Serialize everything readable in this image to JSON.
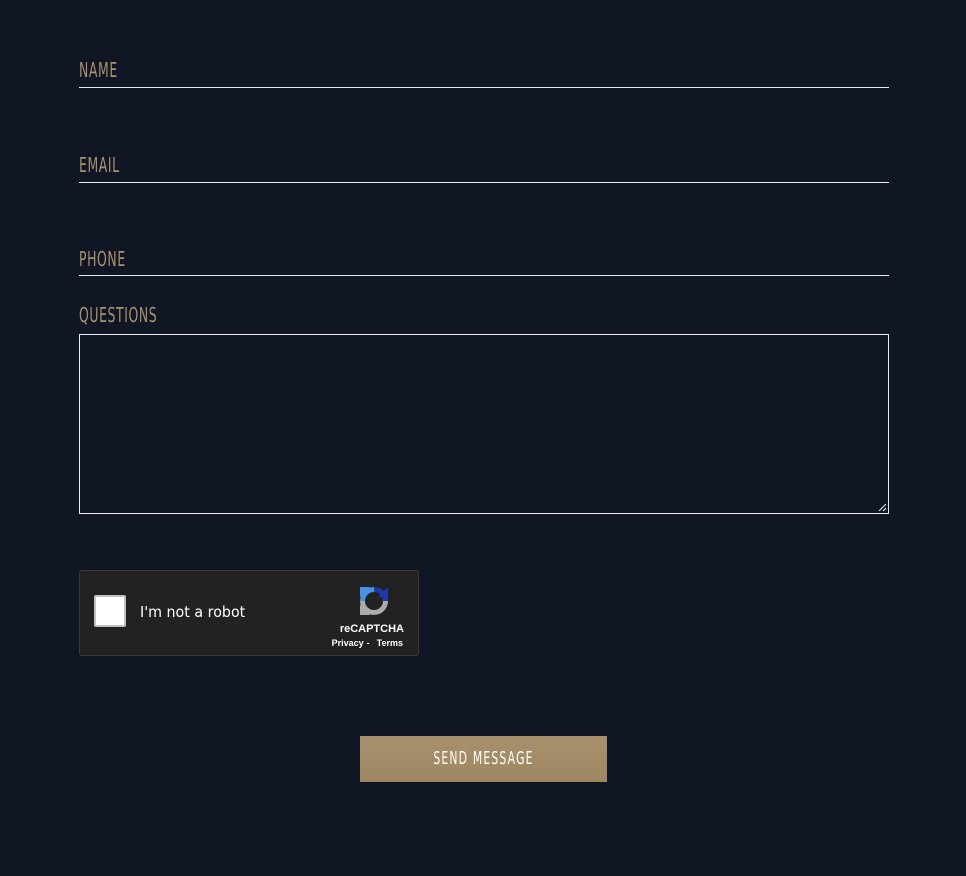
{
  "form": {
    "name": {
      "label": "NAME",
      "value": ""
    },
    "email": {
      "label": "EMAIL",
      "value": ""
    },
    "phone": {
      "label": "PHONE",
      "value": ""
    },
    "questions": {
      "label": "QUESTIONS",
      "value": ""
    }
  },
  "recaptcha": {
    "label": "I'm not a robot",
    "brand": "reCAPTCHA",
    "privacy_link": "Privacy",
    "separator": "-",
    "terms_link": "Terms",
    "checked": false,
    "logo_icon": "recaptcha-logo-icon"
  },
  "submit": {
    "label": "SEND MESSAGE"
  },
  "colors": {
    "background": "#101624",
    "label": "#a89171",
    "line": "#e9e9ea",
    "button": "#a9916d",
    "recaptcha_bg": "#222222"
  }
}
